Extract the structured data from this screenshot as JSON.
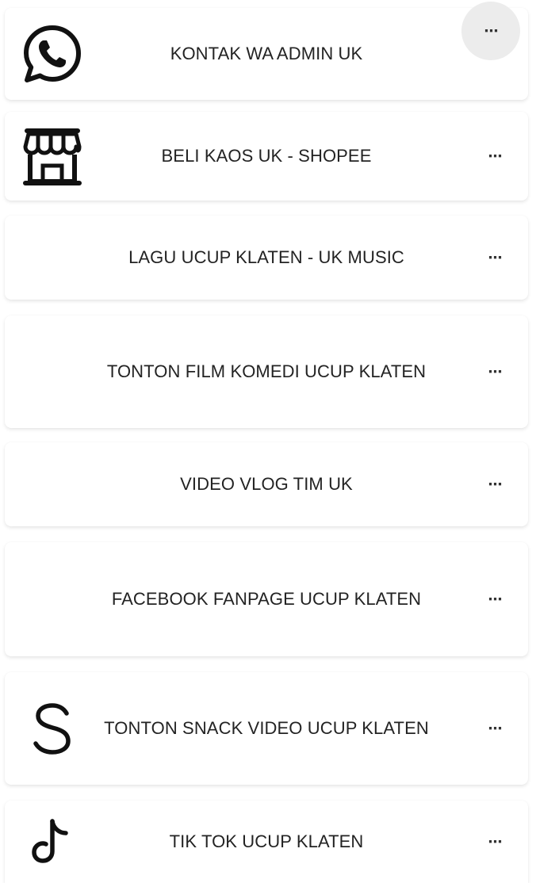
{
  "links": [
    {
      "label": "KONTAK WA ADMIN UK",
      "icon": "whatsapp-icon",
      "more": "⋯"
    },
    {
      "label": "BELI KAOS UK - SHOPEE",
      "icon": "shop-icon",
      "more": "⋯"
    },
    {
      "label": "LAGU UCUP KLATEN - UK MUSIC",
      "icon": "",
      "more": "⋯"
    },
    {
      "label": "TONTON FILM KOMEDI UCUP KLATEN",
      "icon": "",
      "more": "⋯"
    },
    {
      "label": "VIDEO VLOG TIM UK",
      "icon": "",
      "more": "⋯"
    },
    {
      "label": "FACEBOOK FANPAGE UCUP KLATEN",
      "icon": "",
      "more": "⋯"
    },
    {
      "label": "TONTON SNACK VIDEO UCUP KLATEN",
      "icon": "snack-video-s-icon",
      "more": "⋯"
    },
    {
      "label": "TIK TOK UCUP KLATEN",
      "icon": "tiktok-icon",
      "more": "⋯"
    }
  ],
  "overlay": {
    "more": "⋯"
  }
}
